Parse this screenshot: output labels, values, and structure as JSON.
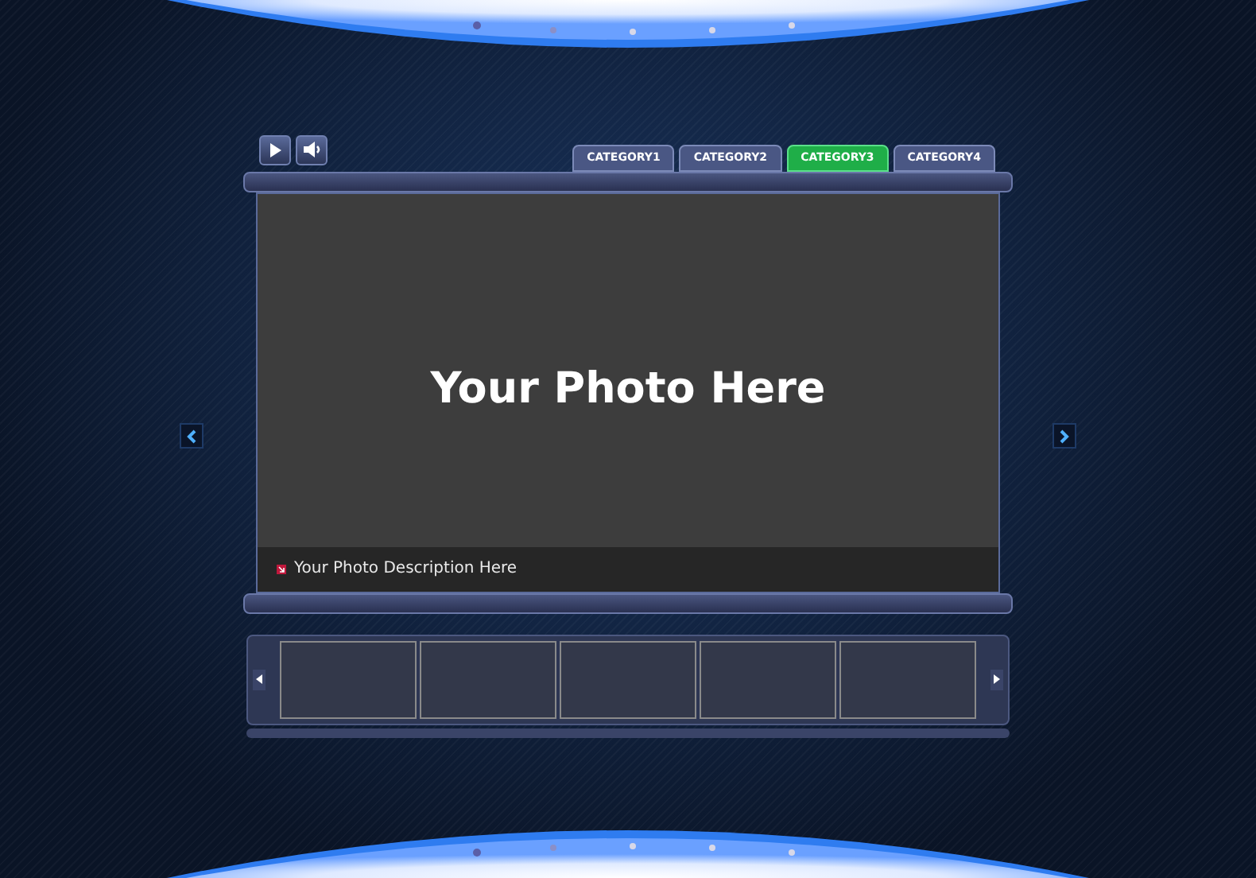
{
  "player_controls": [
    {
      "kind": "play"
    },
    {
      "kind": "sound"
    }
  ],
  "tabs": [
    {
      "label": "CATEGORY1",
      "selected": false
    },
    {
      "label": "CATEGORY2",
      "selected": false
    },
    {
      "label": "CATEGORY3",
      "selected": true
    },
    {
      "label": "CATEGORY4",
      "selected": false
    }
  ],
  "photo": {
    "placeholder": "Your Photo Here",
    "description": "Your Photo Description Here"
  },
  "thumbnails": [
    {
      "selected": false
    },
    {
      "selected": false
    },
    {
      "selected": false
    },
    {
      "selected": false
    },
    {
      "selected": false
    }
  ]
}
